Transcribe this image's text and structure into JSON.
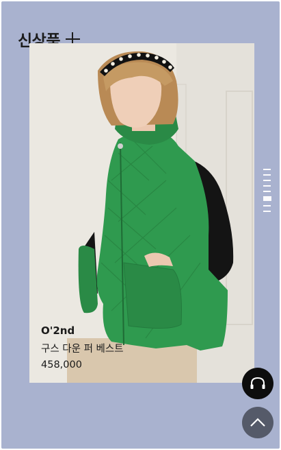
{
  "section": {
    "title": "신상품"
  },
  "product": {
    "brand": "O'2nd",
    "name": "구스 다운 퍼 베스트",
    "price": "458,000"
  },
  "pager": {
    "count": 8,
    "active_index": 6
  },
  "icons": {
    "more": "plus-icon",
    "headset": "headset-icon",
    "scroll_top": "chevron-up-icon"
  },
  "colors": {
    "background": "#a9b2cf",
    "headset_button": "#0d0d0d",
    "top_button": "#555a69",
    "vest": "#2f9a4f"
  }
}
